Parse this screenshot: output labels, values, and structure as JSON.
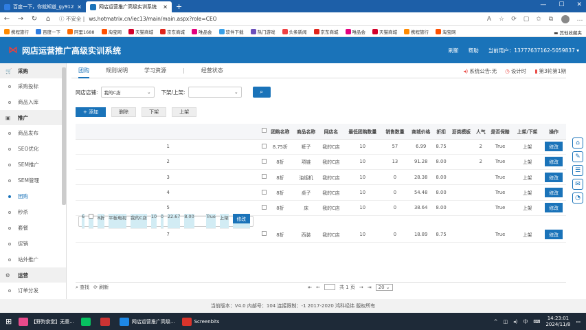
{
  "browser": {
    "tabs": [
      {
        "label": "百度一下，你就知道_gy912导航",
        "active": false,
        "color": "#2f7de1"
      },
      {
        "label": "网店运营推广高级实训系统",
        "active": true,
        "color": "#1a73b9"
      }
    ],
    "new_tab": "+",
    "window_controls": [
      "—",
      "☐",
      "✕"
    ],
    "security": "不安全",
    "url": "ws.hotmatrix.cn/iec13/main/main.aspx?role=CEO",
    "bookmarks": [
      {
        "label": "携程旅行",
        "color": "#ff8a00"
      },
      {
        "label": "百度一下",
        "color": "#2f7de1"
      },
      {
        "label": "阿里1688",
        "color": "#ff6a00"
      },
      {
        "label": "淘宝网",
        "color": "#ff5000"
      },
      {
        "label": "天猫商城",
        "color": "#d4002a"
      },
      {
        "label": "京东商城",
        "color": "#e1251b"
      },
      {
        "label": "唯品会",
        "color": "#e4007f"
      },
      {
        "label": "软件下载",
        "color": "#3aa0e8"
      },
      {
        "label": "热门游戏",
        "color": "#6b4fbb"
      },
      {
        "label": "头条新闻",
        "color": "#f04142"
      },
      {
        "label": "京东商城",
        "color": "#e1251b"
      },
      {
        "label": "唯品会",
        "color": "#e4007f"
      },
      {
        "label": "天猫商城",
        "color": "#d4002a"
      },
      {
        "label": "携程旅行",
        "color": "#ff8a00"
      },
      {
        "label": "淘宝网",
        "color": "#ff5000"
      }
    ],
    "bookmark_folder": "其他收藏夹"
  },
  "app": {
    "title": "网店运营推广高级实训系统",
    "refresh": "刷新",
    "help": "帮助",
    "user_label": "当前用户：13777637162-5059837 ▾"
  },
  "sidebar": {
    "groups": [
      {
        "label": "采购",
        "items": [
          "采购投标",
          "商品入库"
        ]
      },
      {
        "label": "推广",
        "items": [
          "商品发布",
          "SEO优化",
          "SEM推广",
          "SEM管理",
          "团购",
          "秒杀",
          "套餐",
          "促销",
          "站外推广"
        ]
      },
      {
        "label": "运营",
        "items": [
          "订单分发"
        ]
      }
    ],
    "active_item": "团购"
  },
  "content": {
    "tabs": [
      "团购",
      "规则说明",
      "学习资源",
      "经营状态"
    ],
    "active_tab": "团购",
    "notice": "系统公告:无",
    "settings": "设计时",
    "round": "第3轮第1期",
    "filter": {
      "shop_label": "网店店铺:",
      "shop_value": "我的C店",
      "status_label": "下架/上架:",
      "status_value": ""
    },
    "actions": {
      "add": "+ 添加",
      "delete": "删除",
      "unshelve": "下架",
      "shelve": "上架"
    },
    "table": {
      "headers": [
        "",
        "",
        "团购名称",
        "商品名称",
        "网店名",
        "最低团购数量",
        "销售数量",
        "商城价格",
        "折扣",
        "沥类模板",
        "人气",
        "是否保赔",
        "上架/下架",
        "操作"
      ],
      "rows": [
        [
          "1",
          "",
          "8.75折",
          "裤子",
          "我的C店",
          "10",
          "57",
          "6.99",
          "8.75",
          "",
          "2",
          "True",
          "上架",
          "修改"
        ],
        [
          "2",
          "",
          "8折",
          "项链",
          "我的C店",
          "10",
          "13",
          "91.28",
          "8.00",
          "",
          "2",
          "True",
          "上架",
          "修改"
        ],
        [
          "3",
          "",
          "8折",
          "油烟机",
          "我的C店",
          "10",
          "0",
          "28.38",
          "8.00",
          "",
          "",
          "True",
          "上架",
          "修改"
        ],
        [
          "4",
          "",
          "8折",
          "桌子",
          "我的C店",
          "10",
          "0",
          "54.48",
          "8.00",
          "",
          "",
          "True",
          "上架",
          "修改"
        ],
        [
          "5",
          "",
          "8折",
          "床",
          "我的C店",
          "10",
          "0",
          "38.64",
          "8.00",
          "",
          "",
          "True",
          "上架",
          "修改"
        ],
        [
          "6",
          "",
          "8折",
          "平板电视",
          "我的C店",
          "10",
          "0",
          "22.67",
          "8.00",
          "",
          "",
          "True",
          "上架",
          "修改"
        ],
        [
          "7",
          "",
          "8折",
          "西装",
          "我的C店",
          "10",
          "0",
          "18.89",
          "8.75",
          "",
          "",
          "True",
          "上架",
          "修改"
        ]
      ],
      "selected_row": 5
    },
    "pager": {
      "search": "⌕ 查找",
      "refresh": "⟳ 刷新",
      "page_text": "共 1 页",
      "page_size": "20"
    }
  },
  "footer": "当前版本：V4.0 内部号：104 连接限制：-1 2017-2020 鸿科经纬 版权所有",
  "taskbar": {
    "items": [
      {
        "label": "【野狗食堂】无重...",
        "color": "#e84a8b"
      },
      {
        "label": "",
        "color": "#07c160"
      },
      {
        "label": "",
        "color": "#cc3333"
      },
      {
        "label": "网店运营推广高级...",
        "color": "#1e88e5"
      },
      {
        "label": "Screenbits",
        "color": "#d9342b"
      }
    ],
    "ime": "中",
    "time": "14:23:01",
    "date": "2024/11/8"
  }
}
